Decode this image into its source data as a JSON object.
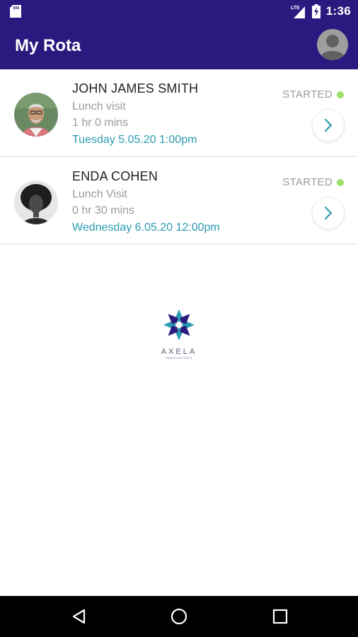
{
  "status_bar": {
    "network": "LTE",
    "time": "1:36"
  },
  "app_bar": {
    "title": "My Rota"
  },
  "visits": [
    {
      "name": "JOHN JAMES SMITH",
      "visit_type": "Lunch visit",
      "duration": "1 hr 0 mins",
      "datetime": "Tuesday 5.05.20 1:00pm",
      "status": "STARTED"
    },
    {
      "name": "ENDA COHEN",
      "visit_type": "Lunch Visit",
      "duration": "0 hr 30 mins",
      "datetime": "Wednesday 6.05.20 12:00pm",
      "status": "STARTED"
    }
  ],
  "logo": {
    "brand": "AXELA",
    "tagline": "INNOVATIONS"
  },
  "colors": {
    "primary": "#2a1a80",
    "accent": "#2b9bb2",
    "status_started": "#9ede6a"
  }
}
